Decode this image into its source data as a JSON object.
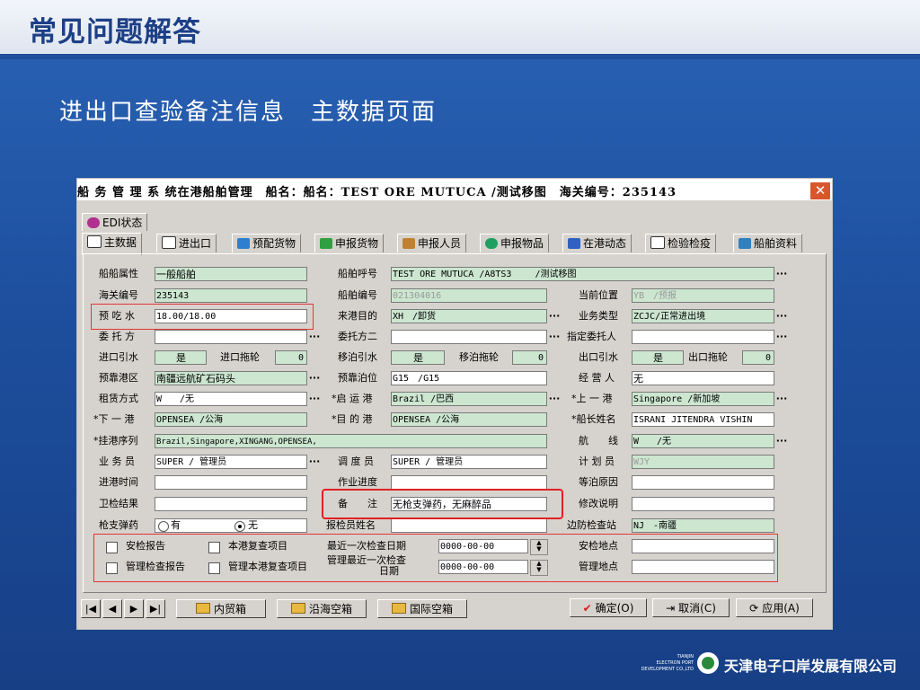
{
  "slide": {
    "title": "常见问题解答",
    "subtitle": "进出口查验备注信息　主数据页面"
  },
  "window": {
    "title": "船 务 管 理 系 统在港船舶管理　船名：船名：TEST ORE MUTUCA /测试移图　海关编号：235143",
    "close_label": "✕"
  },
  "tabs": {
    "edi": "EDI状态",
    "main": "主数据",
    "inout": "进出口",
    "precargo": "预配货物",
    "declare_cargo": "申报货物",
    "declare_people": "申报人员",
    "declare_items": "申报物品",
    "dynamics": "在港动态",
    "inspection": "检验检疫",
    "ship_info": "船舶资料"
  },
  "form": {
    "ship_attr": {
      "label": "船船属性",
      "value": "一般船舶"
    },
    "ship_call": {
      "label": "船舶呼号",
      "value": "TEST ORE MUTUCA /A8TS3　　 /测试移图"
    },
    "customs_no": {
      "label": "海关编号",
      "value": "235143"
    },
    "ship_no": {
      "label": "船舶编号",
      "value": "021304016"
    },
    "cur_pos": {
      "label": "当前位置",
      "value": "YB　/预报"
    },
    "draft": {
      "label": "预 吃 水",
      "value": "18.00/18.00"
    },
    "purpose": {
      "label": "来港目的",
      "value": "XH　/卸货"
    },
    "biz_type": {
      "label": "业务类型",
      "value": "ZCJC/正常进出境"
    },
    "principal": {
      "label": "委 托 方",
      "value": ""
    },
    "principal2": {
      "label": "委托方二",
      "value": ""
    },
    "designated": {
      "label": "指定委托人",
      "value": ""
    },
    "in_pilot": {
      "label": "进口引水",
      "value": "是"
    },
    "in_tug": {
      "label": "进口拖轮",
      "value": "0"
    },
    "shift_pilot": {
      "label": "移泊引水",
      "value": "是"
    },
    "shift_tug": {
      "label": "移泊拖轮",
      "value": "0"
    },
    "out_pilot": {
      "label": "出口引水",
      "value": "是"
    },
    "out_tug": {
      "label": "出口拖轮",
      "value": "0"
    },
    "pre_area": {
      "label": "预靠港区",
      "value": "南疆远航矿石码头"
    },
    "pre_berth": {
      "label": "预靠泊位",
      "value": "G15　/G15"
    },
    "operator": {
      "label": "经 营 人",
      "value": "无"
    },
    "lease": {
      "label": "租赁方式",
      "value": "W　　/无"
    },
    "departure": {
      "label": "*启 运 港",
      "value": "Brazil /巴西"
    },
    "last_port": {
      "label": "*上 一 港",
      "value": "Singapore /新加坡"
    },
    "next_port": {
      "label": "*下 一 港",
      "value": "OPENSEA /公海"
    },
    "dest_port": {
      "label": "*目 的 港",
      "value": "OPENSEA /公海"
    },
    "captain": {
      "label": "*船长姓名",
      "value": "ISRANI JITENDRA VISHIN"
    },
    "port_seq": {
      "label": "*挂港序列",
      "value": "Brazil,Singapore,XINGANG,OPENSEA,"
    },
    "route": {
      "label": "航　　线",
      "value": "W　　/无"
    },
    "clerk": {
      "label": "业 务 员",
      "value": "SUPER / 管理员"
    },
    "dispatcher": {
      "label": "调 度 员",
      "value": "SUPER / 管理员"
    },
    "planner": {
      "label": "计 划 员",
      "value": "WJY"
    },
    "in_time": {
      "label": "进港时间",
      "value": ""
    },
    "progress": {
      "label": "作业进度",
      "value": ""
    },
    "wait_reason": {
      "label": "等泊原因",
      "value": ""
    },
    "health": {
      "label": "卫检结果",
      "value": ""
    },
    "remark": {
      "label": "备　　注",
      "value": "无枪支弹药，无麻醉品"
    },
    "modify_note": {
      "label": "修改说明",
      "value": ""
    },
    "weapons": {
      "label": "枪支弹药",
      "opt_yes": "有",
      "opt_no": "无",
      "selected": "无"
    },
    "inspector": {
      "label": "报检员姓名",
      "value": ""
    },
    "border_station": {
      "label": "边防检查站",
      "value": "NJ　-南疆"
    },
    "security_report": "安检报告",
    "port_recheck": "本港复查项目",
    "last_check_date": {
      "label": "最近一次检查日期",
      "value": "0000-00-00"
    },
    "security_place": {
      "label": "安检地点",
      "value": ""
    },
    "mgmt_report": "管理检查报告",
    "mgmt_port_recheck": "管理本港复查项目",
    "mgmt_last_date": {
      "label_1": "管理最近一次检查",
      "label_2": "日期",
      "value": "0000-00-00"
    },
    "mgmt_place": {
      "label": "管理地点",
      "value": ""
    }
  },
  "bottom": {
    "nav_first": "|◀",
    "nav_prev": "◀",
    "nav_next": "▶",
    "nav_last": "▶|",
    "domestic_box": "内贸箱",
    "coastal_empty": "沿海空箱",
    "intl_empty": "国际空箱",
    "confirm": "确定(O)",
    "cancel": "取消(C)",
    "apply": "应用(A)"
  },
  "logo": {
    "en_1": "TIANJIN",
    "en_2": "ELECTRON PORT",
    "en_3": "DEVELOPMENT CO.,LTD",
    "cn": "天津电子口岸发展有限公司"
  },
  "colors": {
    "field_green": "#cce6d0",
    "highlight_red": "#e02020",
    "title_blue": "#1c3f86"
  }
}
